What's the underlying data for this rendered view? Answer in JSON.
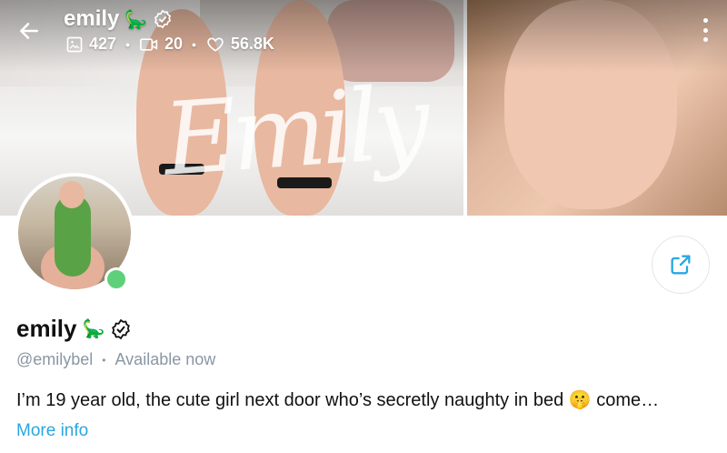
{
  "header": {
    "name": "emily",
    "name_emoji": "🦕",
    "stats": {
      "photos": "427",
      "videos": "20",
      "likes": "56.8K"
    },
    "cover_script": "Emily"
  },
  "profile": {
    "name": "emily",
    "name_emoji": "🦕",
    "handle": "@emilybel",
    "separator": "•",
    "status": "Available now",
    "bio": "I’m 19 year old, the cute girl next door who’s secretly naughty in bed 🤫 come…",
    "more_label": "More info"
  },
  "colors": {
    "link": "#2aa6e3",
    "online": "#5fd07a",
    "muted": "#8a96a3"
  },
  "icons": {
    "back": "arrow-left-icon",
    "verified": "verified-badge-icon",
    "photo": "image-icon",
    "video": "video-icon",
    "like": "heart-icon",
    "menu": "kebab-menu-icon",
    "share": "share-icon"
  }
}
